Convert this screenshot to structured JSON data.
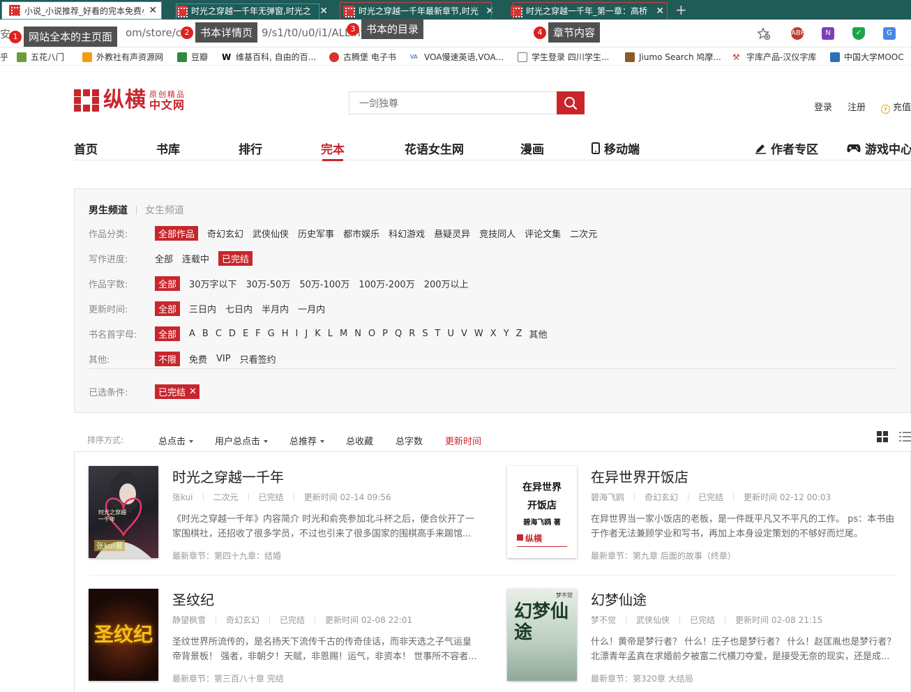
{
  "browser": {
    "tabs": [
      {
        "title": "小说_小说推荐_好看的完本免费小"
      },
      {
        "title": "时光之穿越一千年无弹窗,时光之"
      },
      {
        "title": "时光之穿越一千年最新章节,时光"
      },
      {
        "title": "时光之穿越一千年_第一章：高桥"
      }
    ],
    "url": "安全 | m/store/c0/c0/b0/u0/p1/v9/s1/t0/u0/i1/ALL.html",
    "url_left": "安",
    "url_mid": "om/store/c",
    "url_right": "9/s1/t0/u0/i1/ALL.htm",
    "bookmarks": [
      "乎",
      "五花八门",
      "外教社有声资源网",
      "豆瓣",
      "维基百科, 自由的百...",
      "古腾堡 电子书",
      "VOA慢速英语,VOA...",
      "学生登录 四川学生...",
      "Jiumo Search 鸠摩...",
      "字库产品-汉仪字库",
      "中国大学MOOC"
    ]
  },
  "annotations": [
    {
      "num": "1",
      "label": "网站全本的主页面"
    },
    {
      "num": "2",
      "label": "书本详情页"
    },
    {
      "num": "3",
      "label": "书本的目录"
    },
    {
      "num": "4",
      "label": "章节内容"
    }
  ],
  "site": {
    "logo_main": "纵横",
    "logo_sub_top": "原创精品",
    "logo_sub_bottom": "中文网",
    "search_placeholder": "一剑独尊",
    "login": "登录",
    "register": "注册",
    "recharge": "充值",
    "nav": [
      "首页",
      "书库",
      "排行",
      "完本",
      "花语女生网",
      "漫画",
      "移动端",
      "作者专区",
      "游戏中心"
    ]
  },
  "filters": {
    "channel_on": "男生频道",
    "channel_off": "女生频道",
    "rows": [
      {
        "key": "作品分类:",
        "values": [
          "全部作品",
          "奇幻玄幻",
          "武侠仙侠",
          "历史军事",
          "都市娱乐",
          "科幻游戏",
          "悬疑灵异",
          "竞技同人",
          "评论文集",
          "二次元"
        ],
        "selected": 0
      },
      {
        "key": "写作进度:",
        "values": [
          "全部",
          "连载中",
          "已完结"
        ],
        "selected": 2
      },
      {
        "key": "作品字数:",
        "values": [
          "全部",
          "30万字以下",
          "30万-50万",
          "50万-100万",
          "100万-200万",
          "200万以上"
        ],
        "selected": 0
      },
      {
        "key": "更新时间:",
        "values": [
          "全部",
          "三日内",
          "七日内",
          "半月内",
          "一月内"
        ],
        "selected": 0
      },
      {
        "key": "书名首字母:",
        "values": [
          "全部",
          "A",
          "B",
          "C",
          "D",
          "E",
          "F",
          "G",
          "H",
          "I",
          "J",
          "K",
          "L",
          "M",
          "N",
          "O",
          "P",
          "Q",
          "R",
          "S",
          "T",
          "U",
          "V",
          "W",
          "X",
          "Y",
          "Z",
          "其他"
        ],
        "selected": 0
      },
      {
        "key": "其他:",
        "values": [
          "不限",
          "免费",
          "VIP",
          "只看签约"
        ],
        "selected": 0
      }
    ],
    "chosen_key": "已选条件:",
    "chosen_chip": "已完结"
  },
  "sort": {
    "label": "排序方式:",
    "items": [
      "总点击",
      "用户总点击",
      "总推荐",
      "总收藏",
      "总字数",
      "更新时间"
    ]
  },
  "books": [
    {
      "title": "时光之穿越一千年",
      "author": "张kui",
      "genre": "二次元",
      "status": "已完结",
      "update_label": "更新时间",
      "update": "02-14 09:56",
      "desc": "《时光之穿越一千年》内容简介 时光和俞亮参加北斗杯之后，便合伙开了一家围棋社，还招收了很多学员，不过也引来了很多国家的围棋高手来踢馆...",
      "latest": "最新章节：第四十九章：结婚",
      "cover_text": "时光之穿越一千年",
      "cover_author": "张kui著"
    },
    {
      "title": "在异世界开饭店",
      "author": "碧海飞鸥",
      "genre": "奇幻玄幻",
      "status": "已完结",
      "update_label": "更新时间",
      "update": "02-12 00:03",
      "desc": "在异世界当一家小饭店的老板，是一件既平凡又不平凡的工作。 ps：本书由于作者无法兼顾学业和写书，再加上本身设定策划的不够好而烂尾。",
      "latest": "最新章节：第九章 后面的故事（终章）",
      "cover_text1": "在异世界",
      "cover_text2": "开饭店",
      "cover_author": "碧海飞鸥 著",
      "cover_brand": "纵横"
    },
    {
      "title": "圣纹纪",
      "author": "静望枫雪",
      "genre": "奇幻玄幻",
      "status": "已完结",
      "update_label": "更新时间",
      "update": "02-08 22:01",
      "desc": "圣纹世界所流传的，是名扬天下流传千古的传奇佳话，而非天选之子气运皇帝背景板！ 强者，非朝夕！天赋，非恩赐！运气，非资本！ 世事所不容者...",
      "latest": "最新章节：第三百八十章 完结",
      "cover_text": "圣纹纪"
    },
    {
      "title": "幻梦仙途",
      "author": "梦不觉",
      "genre": "武侠仙侠",
      "status": "已完结",
      "update_label": "更新时间",
      "update": "02-08 21:15",
      "desc": "什么！黄帝是梦行者？ 什么！庄子也是梦行者？ 什么！赵匡胤也是梦行者？ 北漂青年孟真在求婚前夕被富二代横刀夺爱，是接受无奈的现实，还是成...",
      "latest": "最新章节：第320章 大结局",
      "cover_text": "幻梦仙途",
      "cover_author": "梦不觉"
    }
  ],
  "colors": {
    "brand": "#c8262c",
    "tabbar": "#1f5b57",
    "annotation": "#e02020"
  }
}
